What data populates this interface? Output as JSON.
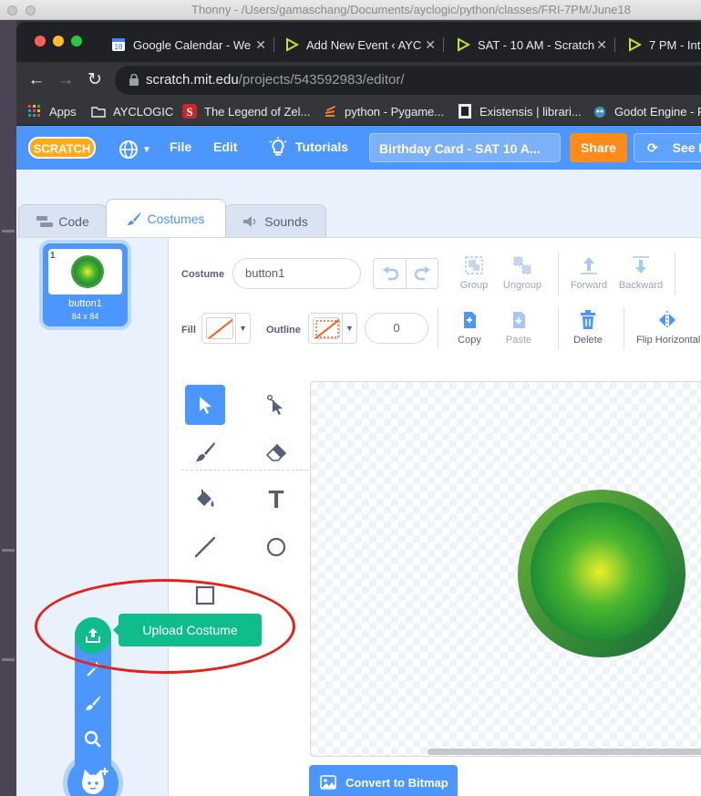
{
  "thonny": {
    "title": "Thonny  -  /Users/gamaschang/Documents/ayclogic/python/classes/FRI-7PM/June18"
  },
  "browser": {
    "tabs": [
      {
        "label": "Google Calendar - We",
        "icon": "google-calendar-icon"
      },
      {
        "label": "Add New Event ‹ AYC",
        "icon": "play-triangle-icon"
      },
      {
        "label": "SAT - 10 AM - Scratch",
        "icon": "play-triangle-icon"
      },
      {
        "label": "7 PM - Int",
        "icon": "play-triangle-icon"
      }
    ],
    "url_host": "scratch.mit.edu",
    "url_path": "/projects/543592983/editor/",
    "bookmarks": [
      {
        "label": "Apps",
        "icon": "apps-grid-icon"
      },
      {
        "label": "AYCLOGIC",
        "icon": "folder-icon"
      },
      {
        "label": "The Legend of Zel...",
        "icon": "s-logo-icon"
      },
      {
        "label": "python - Pygame...",
        "icon": "stack-icon"
      },
      {
        "label": "Existensis | librari...",
        "icon": "book-icon"
      },
      {
        "label": "Godot Engine - F",
        "icon": "godot-icon"
      }
    ]
  },
  "scratch": {
    "logo_text": "SCRATCH",
    "menu": {
      "file": "File",
      "edit": "Edit",
      "tutorials": "Tutorials"
    },
    "project_title": "Birthday Card - SAT 10 A...",
    "share": "Share",
    "see_project": "See P",
    "tabs": {
      "code": "Code",
      "costumes": "Costumes",
      "sounds": "Sounds"
    },
    "costume": {
      "number": "1",
      "name": "button1",
      "size": "84 x 84"
    },
    "tooltip": "Upload Costume",
    "editor": {
      "costume_label": "Costume",
      "costume_name": "button1",
      "fill_label": "Fill",
      "outline_label": "Outline",
      "outline_width": "0",
      "group": "Group",
      "ungroup": "Ungroup",
      "forward": "Forward",
      "backward": "Backward",
      "copy": "Copy",
      "paste": "Paste",
      "delete": "Delete",
      "flip_horizontal": "Flip Horizontal",
      "tools_text_glyph": "T",
      "convert": "Convert to Bitmap"
    },
    "colors": {
      "accent": "#4c97ff",
      "share": "#ff8c1a",
      "upload": "#0fbd8c",
      "highlight": "#e2231a"
    }
  }
}
